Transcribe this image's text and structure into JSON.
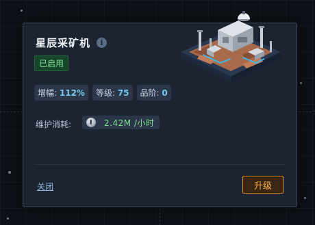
{
  "building": {
    "name": "星辰采矿机",
    "status": "已启用",
    "stats": {
      "boost_label": "增幅:",
      "boost_value": "112%",
      "level_label": "等级:",
      "level_value": "75",
      "grade_label": "品阶:",
      "grade_value": "0"
    },
    "upkeep": {
      "label": "维护消耗:",
      "value": "2.42M /小时",
      "icon": "crystal-icon"
    }
  },
  "actions": {
    "close_label": "关闭",
    "upgrade_label": "升级"
  },
  "colors": {
    "panel_bg": "#1c2431",
    "status_green": "#7fe08f",
    "stat_blue": "#76c9ee",
    "upgrade_orange": "#e08a1e"
  }
}
